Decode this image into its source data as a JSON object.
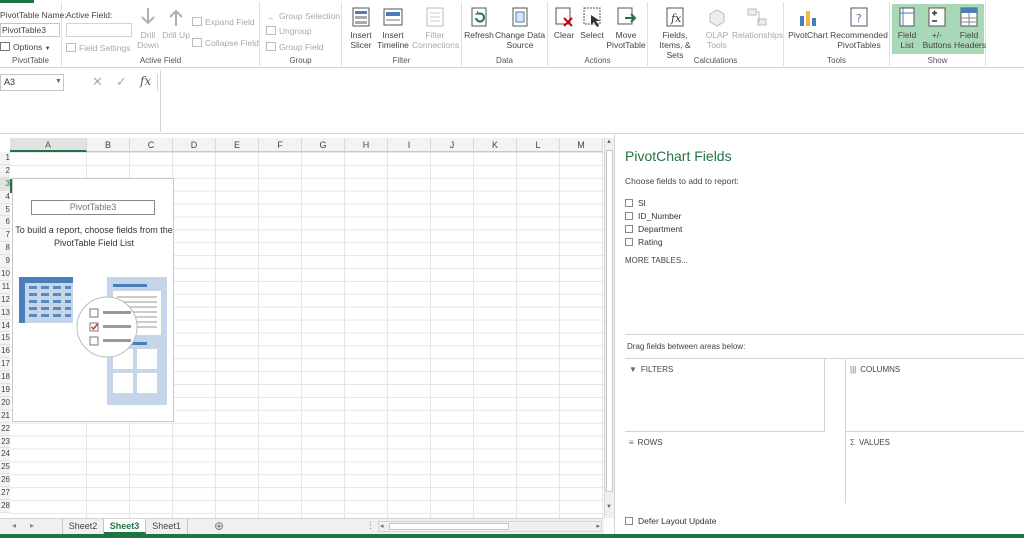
{
  "ribbon": {
    "pivottable_group": {
      "name_label": "PivotTable Name:",
      "name_value": "PivotTable3",
      "options_label": "Options",
      "group_label": "PivotTable"
    },
    "active_field_group": {
      "label": "Active Field:",
      "field_settings": "Field Settings",
      "drill_down": "Drill Down",
      "drill_up": "Drill Up",
      "expand_field": "Expand Field",
      "collapse_field": "Collapse Field",
      "group_label": "Active Field"
    },
    "group_group": {
      "group_selection": "Group Selection",
      "ungroup": "Ungroup",
      "group_field": "Group Field",
      "group_label": "Group"
    },
    "filter_group": {
      "insert_slicer": "Insert Slicer",
      "insert_timeline": "Insert Timeline",
      "filter_connections": "Filter Connections",
      "group_label": "Filter"
    },
    "data_group": {
      "refresh": "Refresh",
      "change_data_source": "Change Data Source",
      "group_label": "Data"
    },
    "actions_group": {
      "clear": "Clear",
      "select": "Select",
      "move_pivottable": "Move PivotTable",
      "group_label": "Actions"
    },
    "calculations_group": {
      "fields_items_sets": "Fields, Items, & Sets",
      "olap_tools": "OLAP Tools",
      "relationships": "Relationships",
      "group_label": "Calculations"
    },
    "tools_group": {
      "pivotchart": "PivotChart",
      "recommended_pivottables": "Recommended PivotTables",
      "group_label": "Tools"
    },
    "show_group": {
      "field_list": "Field List",
      "buttons": "+/- Buttons",
      "field_headers": "Field Headers",
      "group_label": "Show"
    }
  },
  "formula_bar": {
    "name_box": "A3",
    "fx_label": "fx"
  },
  "grid": {
    "columns": [
      "A",
      "B",
      "C",
      "D",
      "E",
      "F",
      "G",
      "H",
      "I",
      "J",
      "K",
      "L",
      "M"
    ],
    "rows": [
      "1",
      "2",
      "3",
      "4",
      "5",
      "6",
      "7",
      "8",
      "9",
      "10",
      "11",
      "12",
      "13",
      "14",
      "15",
      "16",
      "17",
      "18",
      "19",
      "20",
      "21",
      "22",
      "23",
      "24",
      "25",
      "26",
      "27",
      "28"
    ],
    "active_column": "A",
    "active_row": "3"
  },
  "pivot_placeholder": {
    "name": "PivotTable3",
    "message": "To build a report, choose fields from the PivotTable Field List"
  },
  "sheets": {
    "tabs": [
      "Sheet2",
      "Sheet3",
      "Sheet1"
    ],
    "active": "Sheet3"
  },
  "task_pane": {
    "title": "PivotChart Fields",
    "subtitle": "Choose fields to add to report:",
    "fields": [
      "Sl",
      "ID_Number",
      "Department",
      "Rating"
    ],
    "more_tables": "MORE TABLES...",
    "drag_label": "Drag fields between areas below:",
    "areas": {
      "filters": "FILTERS",
      "columns": "COLUMNS",
      "rows": "ROWS",
      "values": "VALUES"
    },
    "defer_update": "Defer Layout Update"
  },
  "colors": {
    "accent": "#217346",
    "show_selected": "#a9d8b7"
  }
}
